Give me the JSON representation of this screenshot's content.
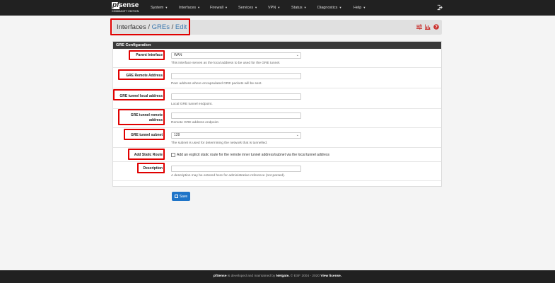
{
  "navbar": {
    "logo_pf": "pf",
    "logo_sense": "sense",
    "logo_edition": "COMMUNITY EDITION",
    "menu": [
      {
        "label": "System"
      },
      {
        "label": "Interfaces"
      },
      {
        "label": "Firewall"
      },
      {
        "label": "Services"
      },
      {
        "label": "VPN"
      },
      {
        "label": "Status"
      },
      {
        "label": "Diagnostics"
      },
      {
        "label": "Help"
      }
    ]
  },
  "breadcrumb": {
    "root": "Interfaces",
    "sep1": "/",
    "gres": "GREs",
    "sep2": "/",
    "edit": "Edit"
  },
  "panel": {
    "title": "GRE Configuration",
    "fields": {
      "parent_interface": {
        "label": "Parent Interface",
        "value": "WAN",
        "help": "This interface serves as the local address to be used for the GRE tunnel."
      },
      "remote_address": {
        "label": "GRE Remote Address",
        "value": "",
        "help": "Peer address where encapsulated GRE packets will be sent."
      },
      "local_address": {
        "label": "GRE tunnel local address",
        "value": "",
        "help": "Local GRE tunnel endpoint."
      },
      "tunnel_remote": {
        "label_line1": "GRE tunnel remote",
        "label_line2": "address",
        "value": "",
        "help": "Remote GRE address endpoint."
      },
      "tunnel_subnet": {
        "label": "GRE tunnel subnet",
        "value": "128",
        "help": "The subnet is used for determining the network that is tunnelled."
      },
      "static_route": {
        "label": "Add Static Route",
        "checked": false,
        "text": "Add an explicit static route for the remote inner tunnel address/subnet via the local tunnel address"
      },
      "description": {
        "label": "Description",
        "value": "",
        "help": "A description may be entered here for administrative reference (not parsed)."
      }
    }
  },
  "save_button": {
    "label": "Save"
  },
  "footer": {
    "brand": "pfSense",
    "middle": " is developed and maintained by ",
    "company": "Netgate.",
    "copyright": " © ESF 2004 - 2020 ",
    "license": "View license."
  },
  "colors": {
    "accent": "#3b78ae",
    "navbar": "#212121",
    "annotation": "#e00000",
    "save": "#1e74c8"
  }
}
